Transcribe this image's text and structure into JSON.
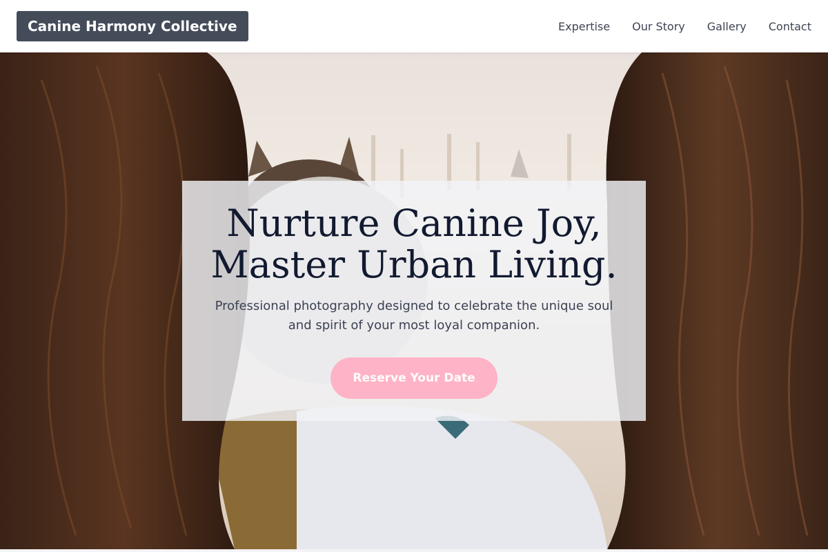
{
  "header": {
    "brand": "Canine Harmony Collective",
    "nav": [
      {
        "label": "Expertise"
      },
      {
        "label": "Our Story"
      },
      {
        "label": "Gallery"
      },
      {
        "label": "Contact"
      }
    ]
  },
  "hero": {
    "headline_line1": "Nurture Canine Joy,",
    "headline_line2": "Master Urban Living.",
    "subtitle": "Professional photography designed to celebrate the unique soul and spirit of your most loyal companion.",
    "cta_label": "Reserve Your Date",
    "image_subject": "two people with long brown hair seen from behind holding a dog, warm sunset light"
  },
  "colors": {
    "logo_bg": "#444c5a",
    "headline": "#121a30",
    "body_text": "#3a4252",
    "cta_bg": "#ffb3c6",
    "cta_text": "#ffffff"
  }
}
